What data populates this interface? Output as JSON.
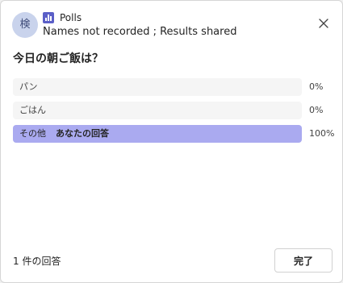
{
  "header": {
    "avatar_text": "検",
    "app_name": "Polls",
    "app_icon": "poll-chart-icon",
    "subtitle": "Names not recorded ; Results shared",
    "close_icon": "close-icon"
  },
  "question": "今日の朝ご飯は？",
  "options": [
    {
      "label": "パン",
      "percent_text": "0%",
      "percent": 0,
      "your_answer": ""
    },
    {
      "label": "ごはん",
      "percent_text": "0%",
      "percent": 0,
      "your_answer": ""
    },
    {
      "label": "その他",
      "percent_text": "100%",
      "percent": 100,
      "your_answer": "あなたの回答"
    }
  ],
  "footer": {
    "response_count": "1 件の回答",
    "done_label": "完了"
  },
  "colors": {
    "accent": "#5b5fc7",
    "result_fill": "#aaaaf0",
    "bar_background": "#f5f5f5"
  }
}
